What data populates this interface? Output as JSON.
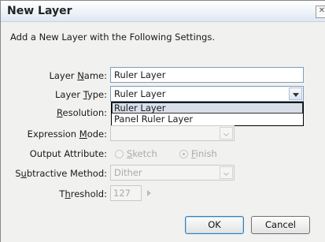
{
  "dialog": {
    "title": "New Layer",
    "heading": "Add a New Layer with the Following Settings."
  },
  "fields": {
    "layer_name": {
      "label_pre": "Layer ",
      "label_u": "N",
      "label_post": "ame:",
      "value": "Ruler Layer"
    },
    "layer_type": {
      "label_pre": "Layer ",
      "label_u": "T",
      "label_post": "ype:",
      "value": "Ruler Layer",
      "options": [
        "Ruler Layer",
        "Panel Ruler Layer"
      ]
    },
    "resolution": {
      "label_pre": "",
      "label_u": "R",
      "label_post": "esolution:"
    },
    "expression_mode": {
      "label_pre": "Expression ",
      "label_u": "M",
      "label_post": "ode:"
    },
    "output_attribute": {
      "label": "Output Attribute:",
      "option1_u": "S",
      "option1_rest": "ketch",
      "option2_u": "F",
      "option2_rest": "inish"
    },
    "subtractive_method": {
      "label_pre": "S",
      "label_u": "u",
      "label_post": "btractive Method:",
      "value": "Dither"
    },
    "threshold": {
      "label_pre": "T",
      "label_u": "h",
      "label_post": "reshold:",
      "value": "127"
    }
  },
  "buttons": {
    "ok": "OK",
    "cancel": "Cancel"
  },
  "icons": {
    "close": "close-icon",
    "dropdown": "chevron-down-icon",
    "increment": "triangle-right-icon"
  }
}
